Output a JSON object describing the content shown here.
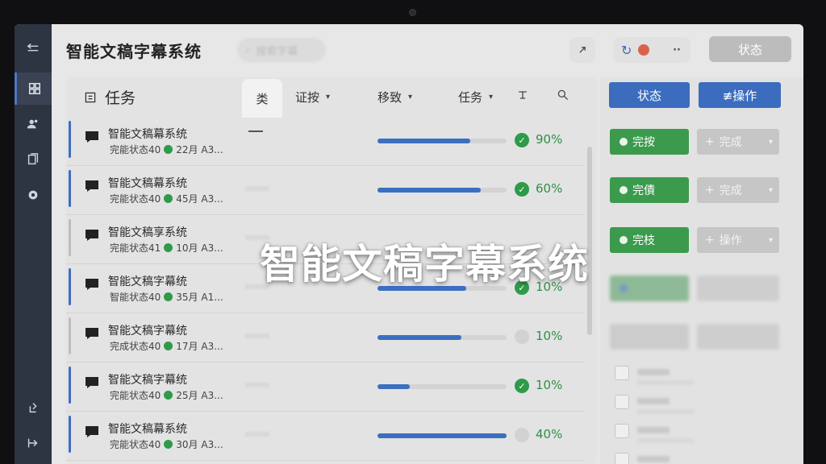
{
  "app": {
    "title": "智能文稿字幕系统",
    "search_placeholder": "搜索字幕"
  },
  "header": {
    "status_button": "状态"
  },
  "panel": {
    "title": "任务",
    "tabs": [
      {
        "label": "类",
        "active": true
      },
      {
        "label": "证按"
      },
      {
        "label": "移致"
      },
      {
        "label": "任务"
      }
    ]
  },
  "tasks": [
    {
      "title": "智能文稿幕系统",
      "status": "完能状态40",
      "meta": "22月 A3...",
      "progress": 0.72,
      "percent": "90%",
      "done": true,
      "accent": true
    },
    {
      "title": "智能文稿幕系统",
      "status": "完能状态40",
      "meta": "45月 A3...",
      "progress": 0.8,
      "percent": "60%",
      "done": true,
      "accent": true
    },
    {
      "title": "智能文稿享系统",
      "status": "完能状态41",
      "meta": "10月 A3...",
      "progress": 0,
      "percent": "",
      "done": true,
      "accent": false
    },
    {
      "title": "智能文稿字幕统",
      "status": "智能状态40",
      "meta": "35月 A1...",
      "progress": 0.69,
      "percent": "10%",
      "done": true,
      "accent": true
    },
    {
      "title": "智能文稿字幕统",
      "status": "完成状态40",
      "meta": "17月 A3...",
      "progress": 0.65,
      "percent": "10%",
      "done": false,
      "accent": false
    },
    {
      "title": "智能文稿字幕统",
      "status": "完能状态40",
      "meta": "25月 A3...",
      "progress": 0.25,
      "percent": "10%",
      "done": true,
      "accent": true
    },
    {
      "title": "智能文稿幕系统",
      "status": "完能状态40",
      "meta": "30月 A3...",
      "progress": 1.0,
      "percent": "40%",
      "done": false,
      "accent": true
    }
  ],
  "right": {
    "status_button": "状态",
    "action_button": "≢操作",
    "rows": [
      {
        "green": "完按",
        "grey": "完成"
      },
      {
        "green": "完債",
        "grey": "完成"
      },
      {
        "green": "完枝",
        "grey": "操作"
      }
    ]
  },
  "overlay_text": "智能文稿字幕系统",
  "colors": {
    "accent_blue": "#3b6cbe",
    "success_green": "#3c9a4d",
    "rail_bg": "#2d3442"
  }
}
